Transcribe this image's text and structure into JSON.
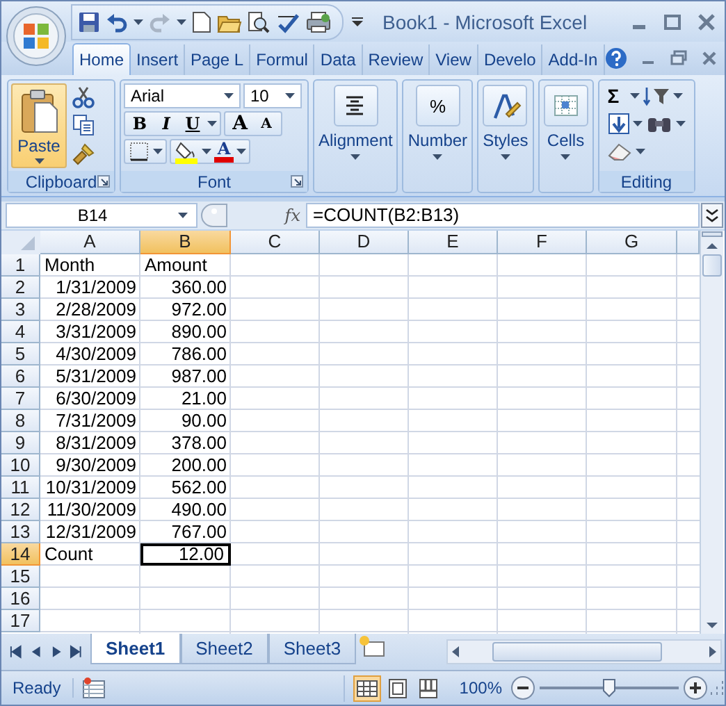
{
  "window": {
    "title": "Book1 - Microsoft Excel"
  },
  "tabs": [
    {
      "label": "Home",
      "selected": true
    },
    {
      "label": "Insert",
      "selected": false
    },
    {
      "label": "Page L",
      "selected": false
    },
    {
      "label": "Formul",
      "selected": false
    },
    {
      "label": "Data",
      "selected": false
    },
    {
      "label": "Review",
      "selected": false
    },
    {
      "label": "View",
      "selected": false
    },
    {
      "label": "Develo",
      "selected": false
    },
    {
      "label": "Add-In",
      "selected": false
    }
  ],
  "ribbon": {
    "clipboard": {
      "label": "Clipboard",
      "paste": "Paste"
    },
    "font": {
      "label": "Font",
      "font_name": "Arial",
      "font_size": "10",
      "format_buttons": [
        {
          "kind": "bold",
          "glyph": "B"
        },
        {
          "kind": "italic",
          "glyph": "I"
        },
        {
          "kind": "underline",
          "glyph": "U"
        }
      ],
      "size_buttons": [
        {
          "kind": "grow",
          "glyph": "A"
        },
        {
          "kind": "shrink",
          "glyph": "A"
        }
      ],
      "font_color": {
        "glyph": "A",
        "color": "#e00000"
      },
      "fill_color": {
        "color": "#ffff00"
      }
    },
    "groups": [
      {
        "kind": "alignment",
        "label": "Alignment"
      },
      {
        "kind": "number",
        "label": "Number",
        "glyph": "%"
      },
      {
        "kind": "styles",
        "label": "Styles"
      },
      {
        "kind": "cells",
        "label": "Cells"
      }
    ],
    "editing": {
      "label": "Editing",
      "sum_glyph": "Σ"
    }
  },
  "formula_bar": {
    "name_box": "B14",
    "fx": "fx",
    "formula": "=COUNT(B2:B13)"
  },
  "sheet": {
    "columns": [
      {
        "label": "A",
        "selected": false
      },
      {
        "label": "B",
        "selected": true
      },
      {
        "label": "C",
        "selected": false
      },
      {
        "label": "D",
        "selected": false
      },
      {
        "label": "E",
        "selected": false
      },
      {
        "label": "F",
        "selected": false
      },
      {
        "label": "G",
        "selected": false
      }
    ],
    "rows": [
      {
        "number": "1",
        "selected": false,
        "cells": [
          {
            "text": "Month",
            "kind": "text",
            "selected": false
          },
          {
            "text": "Amount",
            "kind": "text",
            "selected": false
          }
        ]
      },
      {
        "number": "2",
        "selected": false,
        "cells": [
          {
            "text": "1/31/2009",
            "kind": "number",
            "selected": false
          },
          {
            "text": "360.00",
            "kind": "number",
            "selected": false
          }
        ]
      },
      {
        "number": "3",
        "selected": false,
        "cells": [
          {
            "text": "2/28/2009",
            "kind": "number",
            "selected": false
          },
          {
            "text": "972.00",
            "kind": "number",
            "selected": false
          }
        ]
      },
      {
        "number": "4",
        "selected": false,
        "cells": [
          {
            "text": "3/31/2009",
            "kind": "number",
            "selected": false
          },
          {
            "text": "890.00",
            "kind": "number",
            "selected": false
          }
        ]
      },
      {
        "number": "5",
        "selected": false,
        "cells": [
          {
            "text": "4/30/2009",
            "kind": "number",
            "selected": false
          },
          {
            "text": "786.00",
            "kind": "number",
            "selected": false
          }
        ]
      },
      {
        "number": "6",
        "selected": false,
        "cells": [
          {
            "text": "5/31/2009",
            "kind": "number",
            "selected": false
          },
          {
            "text": "987.00",
            "kind": "number",
            "selected": false
          }
        ]
      },
      {
        "number": "7",
        "selected": false,
        "cells": [
          {
            "text": "6/30/2009",
            "kind": "number",
            "selected": false
          },
          {
            "text": "21.00",
            "kind": "number",
            "selected": false
          }
        ]
      },
      {
        "number": "8",
        "selected": false,
        "cells": [
          {
            "text": "7/31/2009",
            "kind": "number",
            "selected": false
          },
          {
            "text": "90.00",
            "kind": "number",
            "selected": false
          }
        ]
      },
      {
        "number": "9",
        "selected": false,
        "cells": [
          {
            "text": "8/31/2009",
            "kind": "number",
            "selected": false
          },
          {
            "text": "378.00",
            "kind": "number",
            "selected": false
          }
        ]
      },
      {
        "number": "10",
        "selected": false,
        "cells": [
          {
            "text": "9/30/2009",
            "kind": "number",
            "selected": false
          },
          {
            "text": "200.00",
            "kind": "number",
            "selected": false
          }
        ]
      },
      {
        "number": "11",
        "selected": false,
        "cells": [
          {
            "text": "10/31/2009",
            "kind": "number",
            "selected": false
          },
          {
            "text": "562.00",
            "kind": "number",
            "selected": false
          }
        ]
      },
      {
        "number": "12",
        "selected": false,
        "cells": [
          {
            "text": "11/30/2009",
            "kind": "number",
            "selected": false
          },
          {
            "text": "490.00",
            "kind": "number",
            "selected": false
          }
        ]
      },
      {
        "number": "13",
        "selected": false,
        "cells": [
          {
            "text": "12/31/2009",
            "kind": "number",
            "selected": false
          },
          {
            "text": "767.00",
            "kind": "number",
            "selected": false
          }
        ]
      },
      {
        "number": "14",
        "selected": true,
        "cells": [
          {
            "text": "Count",
            "kind": "text",
            "selected": false
          },
          {
            "text": "12.00",
            "kind": "number",
            "selected": true
          }
        ]
      },
      {
        "number": "15",
        "selected": false
      },
      {
        "number": "16",
        "selected": false
      },
      {
        "number": "17",
        "selected": false
      }
    ]
  },
  "sheet_tabs": [
    {
      "label": "Sheet1",
      "selected": true
    },
    {
      "label": "Sheet2",
      "selected": false
    },
    {
      "label": "Sheet3",
      "selected": false
    }
  ],
  "status_bar": {
    "status": "Ready",
    "views": [
      {
        "kind": "normal",
        "selected": true
      },
      {
        "kind": "page_layout",
        "selected": false
      },
      {
        "kind": "page_break",
        "selected": false
      }
    ],
    "zoom": "100%",
    "zoom_slider": {
      "level": 0.5
    }
  }
}
